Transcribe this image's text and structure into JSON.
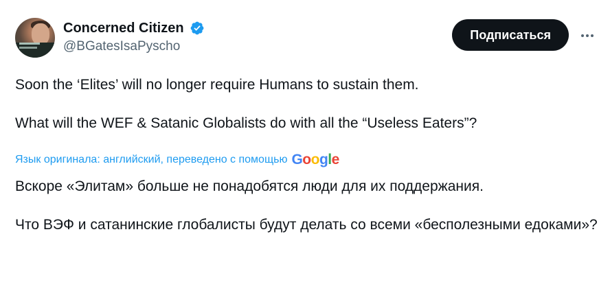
{
  "user": {
    "display_name": "Concerned Citizen",
    "handle": "@BGatesIsaPyscho",
    "verified_color": "#1d9bf0"
  },
  "actions": {
    "follow_label": "Подписаться",
    "more_icon": "ellipsis-icon"
  },
  "tweet": {
    "paragraph_1": "Soon the ‘Elites’ will no longer require Humans to sustain them.",
    "paragraph_2": "What will the WEF & Satanic Globalists do with all the “Useless Eaters”?"
  },
  "translation": {
    "label": "Язык оригинала: английский, переведено с помощью",
    "provider": "Google",
    "paragraph_1": "Вскоре «Элитам» больше не понадобятся люди для их поддержания.",
    "paragraph_2": "Что ВЭФ и сатанинские глобалисты будут делать со всеми «бесполезными едоками»?"
  },
  "colors": {
    "link_blue": "#1d9bf0",
    "text_primary": "#0f1419",
    "text_secondary": "#536471",
    "button_bg": "#0f1419"
  }
}
